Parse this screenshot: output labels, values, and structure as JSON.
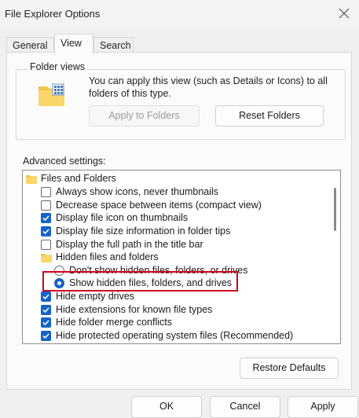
{
  "window": {
    "title": "File Explorer Options"
  },
  "tabs": [
    {
      "label": "General"
    },
    {
      "label": "View"
    },
    {
      "label": "Search"
    }
  ],
  "folder_views": {
    "legend": "Folder views",
    "description": "You can apply this view (such as Details or Icons) to all folders of this type.",
    "apply_button": "Apply to Folders",
    "reset_button": "Reset Folders"
  },
  "advanced": {
    "label": "Advanced settings:",
    "items": [
      {
        "type": "folder",
        "label": "Files and Folders"
      },
      {
        "type": "checkbox",
        "checked": false,
        "label": "Always show icons, never thumbnails"
      },
      {
        "type": "checkbox",
        "checked": false,
        "label": "Decrease space between items (compact view)"
      },
      {
        "type": "checkbox",
        "checked": true,
        "label": "Display file icon on thumbnails"
      },
      {
        "type": "checkbox",
        "checked": true,
        "label": "Display file size information in folder tips"
      },
      {
        "type": "checkbox",
        "checked": false,
        "label": "Display the full path in the title bar"
      },
      {
        "type": "folder",
        "label": "Hidden files and folders"
      },
      {
        "type": "radio",
        "checked": false,
        "label": "Don't show hidden files, folders, or drives"
      },
      {
        "type": "radio",
        "checked": true,
        "label": "Show hidden files, folders, and drives"
      },
      {
        "type": "checkbox",
        "checked": true,
        "label": "Hide empty drives"
      },
      {
        "type": "checkbox",
        "checked": true,
        "label": "Hide extensions for known file types"
      },
      {
        "type": "checkbox",
        "checked": true,
        "label": "Hide folder merge conflicts"
      },
      {
        "type": "checkbox",
        "checked": true,
        "label": "Hide protected operating system files (Recommended)"
      }
    ]
  },
  "buttons": {
    "restore_defaults": "Restore Defaults",
    "ok": "OK",
    "cancel": "Cancel",
    "apply": "Apply"
  },
  "colors": {
    "accent": "#1463c8",
    "highlight_box": "#d0021b",
    "folder_yellow": "#f3c34a"
  }
}
